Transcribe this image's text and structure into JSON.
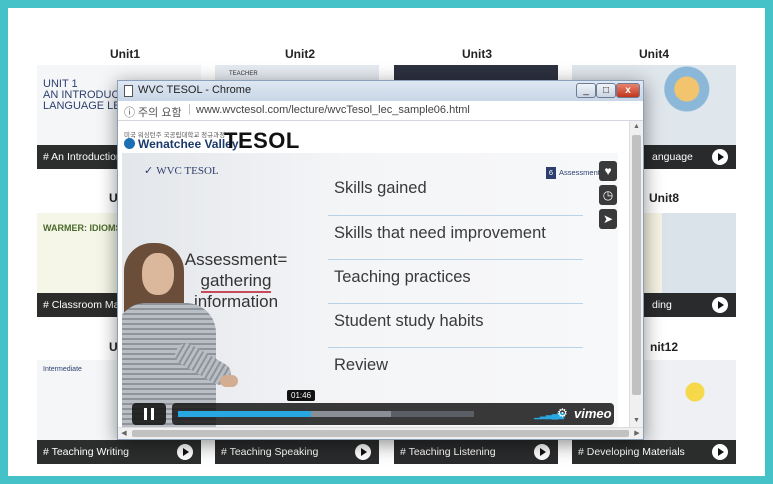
{
  "units": [
    {
      "label": "Unit1",
      "caption": "# An Introduction to Language Lea",
      "thumb_text": [
        "UNIT 1",
        "AN INTRODUCTI",
        "LANGUAGE LEAR"
      ]
    },
    {
      "label": "Unit2",
      "caption": "",
      "thumb_text": [
        "TEACHER"
      ]
    },
    {
      "label": "Unit3",
      "caption": "",
      "thumb_text": []
    },
    {
      "label": "Unit4",
      "caption": "anguage",
      "thumb_text": []
    },
    {
      "label": "Un",
      "caption": "# Classroom Mana",
      "thumb_text": [
        "WARMER: IDIOMS"
      ]
    },
    {
      "label": "Unit8",
      "caption": "ding",
      "thumb_text": []
    },
    {
      "label": "Un",
      "caption": "# Teaching Writing",
      "thumb_text": [
        "Intermediate"
      ]
    },
    {
      "label": "",
      "caption": "# Teaching Speaking",
      "thumb_text": []
    },
    {
      "label": "",
      "caption": "# Teaching Listening",
      "thumb_text": []
    },
    {
      "label": "nit12",
      "caption": "# Developing Materials",
      "thumb_text": []
    }
  ],
  "window": {
    "title": "WVC TESOL - Chrome",
    "minimize": "_",
    "maximize": "□",
    "close": "x",
    "security_label": "ⓘ 주의 요함",
    "url": "www.wvctesol.com/lecture/wvcTesol_lec_sample06.html"
  },
  "logo": {
    "small_text": "미국 워싱턴주 국공립대학교 정규과정",
    "name": "Wenatchee Valley",
    "program": "TESOL"
  },
  "slide": {
    "brand": "WVC TESOL",
    "badge_number": "6",
    "badge_text": "Assessment",
    "bullets": [
      "Skills gained",
      "Skills that need improvement",
      "Teaching practices",
      "Student study habits",
      "Review"
    ],
    "assessment_line1": "Assessment=",
    "assessment_line2": "gathering",
    "assessment_line3": "information"
  },
  "player": {
    "time": "01:46",
    "progress_fraction": 0.45,
    "buffered_fraction": 0.72,
    "brand": "vimeo",
    "side_buttons": [
      "heart-icon",
      "clock-icon",
      "send-icon"
    ]
  },
  "colors": {
    "frame": "#45c1c8",
    "progress": "#28a7e1"
  }
}
